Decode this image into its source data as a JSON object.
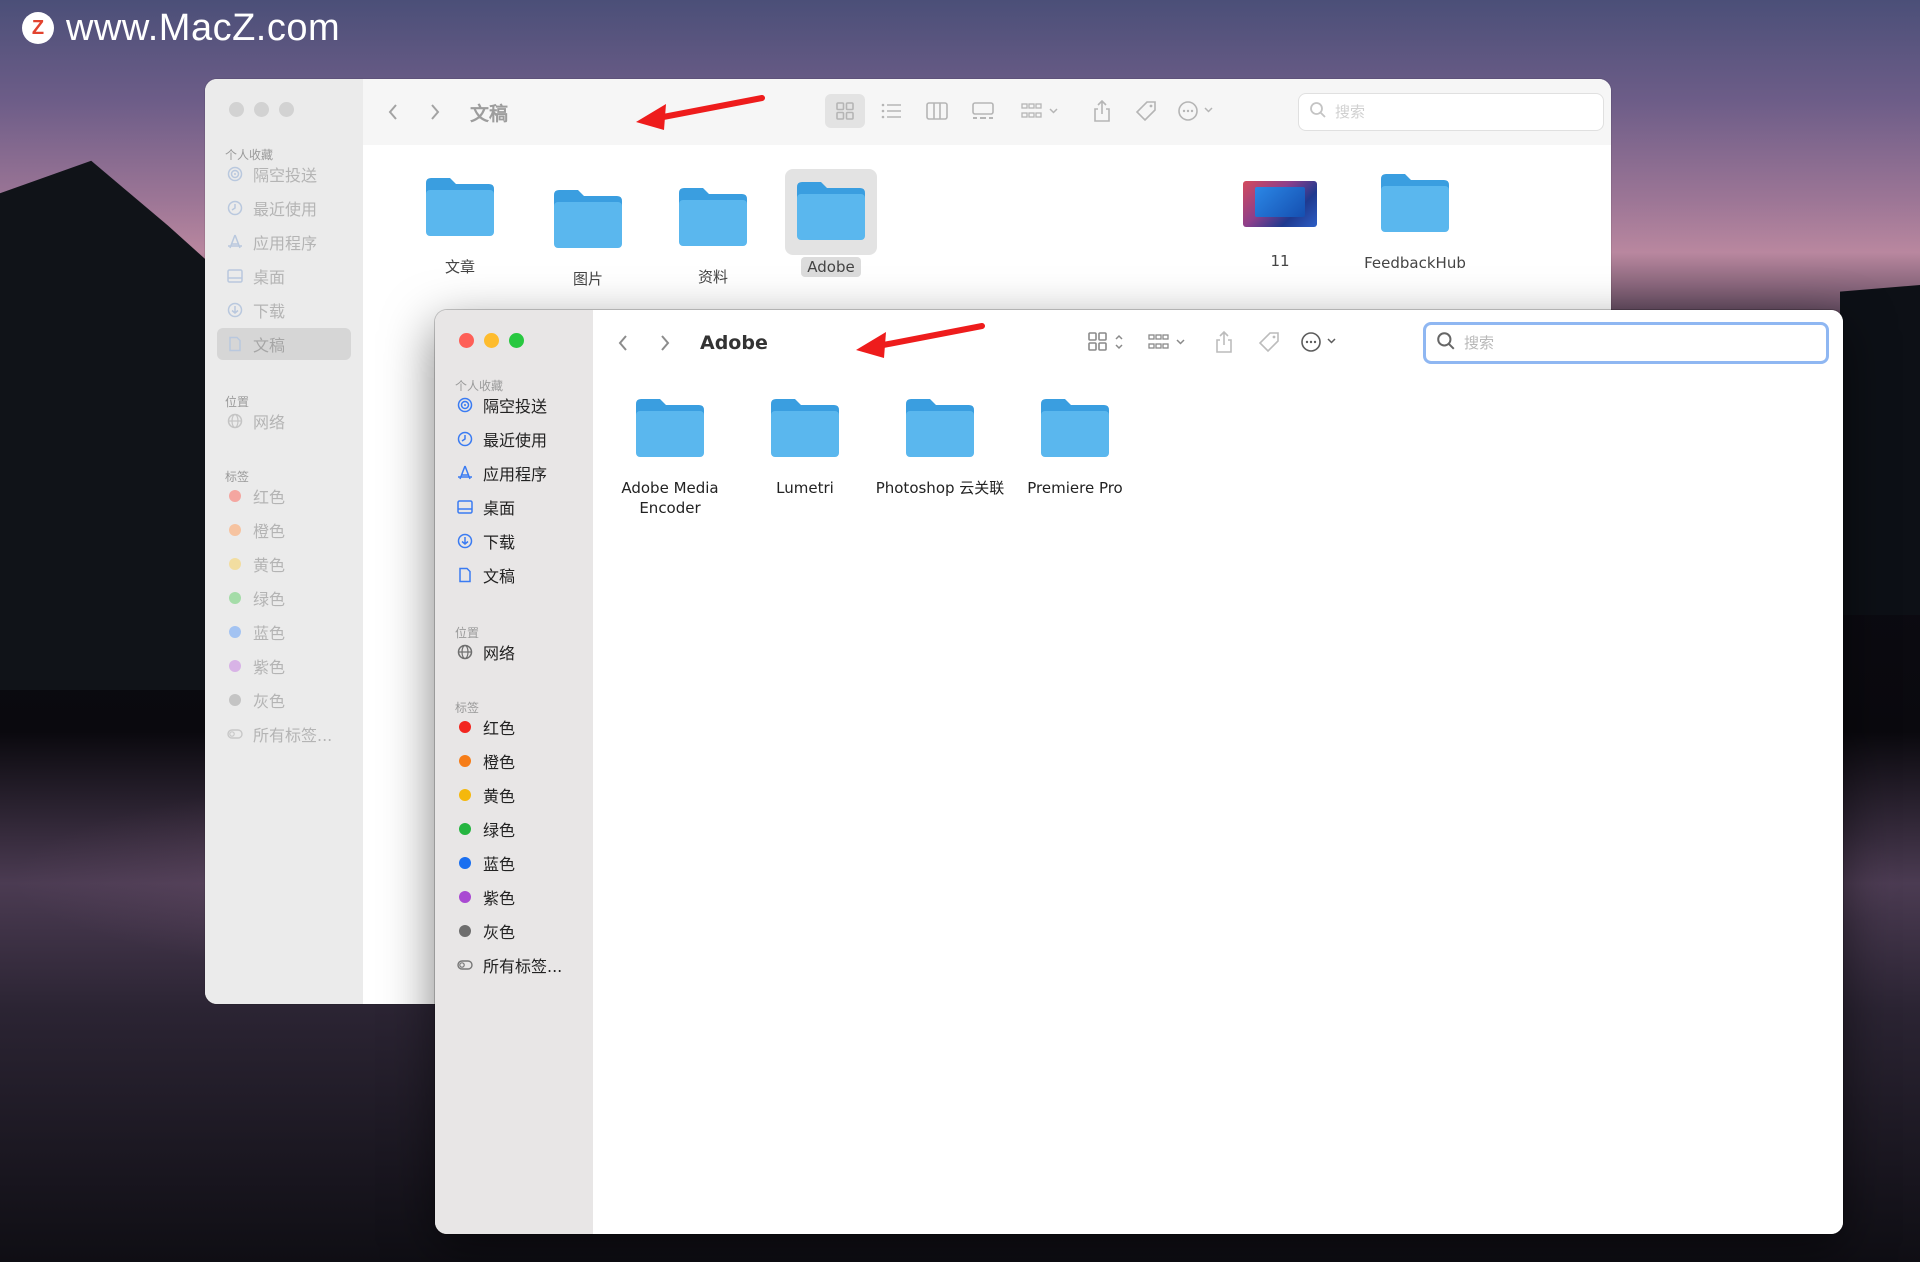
{
  "watermark": {
    "logo_letter": "Z",
    "text": "www.MacZ.com"
  },
  "colors": {
    "folder": "#5ab7ee",
    "folder_tab": "#3a9ee0",
    "accent": "#3a7bf2",
    "arrow": "#ee1c1c",
    "close": "#fe5f57",
    "minimize": "#febc2e",
    "zoom": "#28c840"
  },
  "back_window": {
    "title": "文稿",
    "search_placeholder": "搜索",
    "sidebar": {
      "favorites_header": "个人收藏",
      "favorites": [
        {
          "label": "隔空投送",
          "icon": "airdrop-icon"
        },
        {
          "label": "最近使用",
          "icon": "clock-icon"
        },
        {
          "label": "应用程序",
          "icon": "applications-icon"
        },
        {
          "label": "桌面",
          "icon": "desktop-icon"
        },
        {
          "label": "下载",
          "icon": "download-icon"
        },
        {
          "label": "文稿",
          "icon": "document-icon"
        }
      ],
      "locations_header": "位置",
      "locations": [
        {
          "label": "网络",
          "icon": "globe-icon"
        }
      ],
      "tags_header": "标签",
      "tags": [
        {
          "label": "红色",
          "color": "#f4a6a0"
        },
        {
          "label": "橙色",
          "color": "#f6c3a0"
        },
        {
          "label": "黄色",
          "color": "#f2dda0"
        },
        {
          "label": "绿色",
          "color": "#a4dca8"
        },
        {
          "label": "蓝色",
          "color": "#a3c3f2"
        },
        {
          "label": "紫色",
          "color": "#d8b3e6"
        },
        {
          "label": "灰色",
          "color": "#c4c4c4"
        }
      ],
      "all_tags": "所有标签..."
    },
    "items": [
      {
        "label": "文章",
        "type": "folder"
      },
      {
        "label": "图片",
        "type": "folder"
      },
      {
        "label": "资料",
        "type": "folder"
      },
      {
        "label": "Adobe",
        "type": "folder"
      },
      {
        "label": "11",
        "type": "image"
      },
      {
        "label": "FeedbackHub",
        "type": "folder"
      }
    ]
  },
  "front_window": {
    "title": "Adobe",
    "search_placeholder": "搜索",
    "sidebar": {
      "favorites_header": "个人收藏",
      "favorites": [
        {
          "label": "隔空投送",
          "icon": "airdrop-icon"
        },
        {
          "label": "最近使用",
          "icon": "clock-icon"
        },
        {
          "label": "应用程序",
          "icon": "applications-icon"
        },
        {
          "label": "桌面",
          "icon": "desktop-icon"
        },
        {
          "label": "下载",
          "icon": "download-icon"
        },
        {
          "label": "文稿",
          "icon": "document-icon"
        }
      ],
      "locations_header": "位置",
      "locations": [
        {
          "label": "网络",
          "icon": "globe-icon"
        }
      ],
      "tags_header": "标签",
      "tags": [
        {
          "label": "红色",
          "color": "#f2261f"
        },
        {
          "label": "橙色",
          "color": "#f67d18"
        },
        {
          "label": "黄色",
          "color": "#f5b80c"
        },
        {
          "label": "绿色",
          "color": "#25b540"
        },
        {
          "label": "蓝色",
          "color": "#1a6ff0"
        },
        {
          "label": "紫色",
          "color": "#a94ad2"
        },
        {
          "label": "灰色",
          "color": "#6e6e6e"
        }
      ],
      "all_tags": "所有标签..."
    },
    "items": [
      {
        "label": "Adobe Media Encoder",
        "type": "folder"
      },
      {
        "label": "Lumetri",
        "type": "folder"
      },
      {
        "label": "Photoshop 云关联",
        "type": "folder"
      },
      {
        "label": "Premiere Pro",
        "type": "folder"
      }
    ]
  }
}
